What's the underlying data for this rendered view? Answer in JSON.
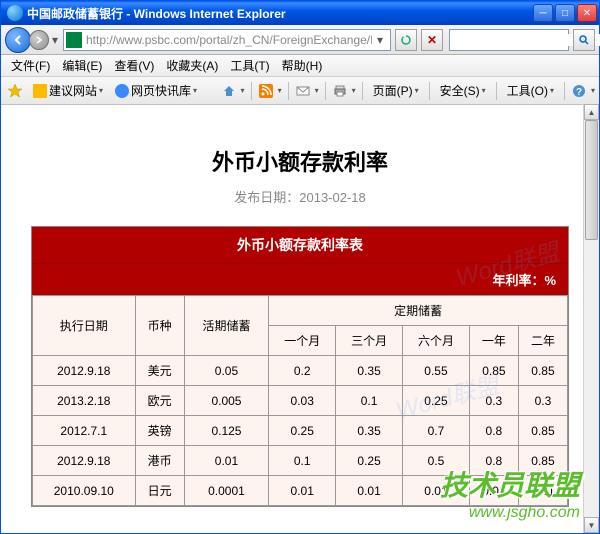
{
  "window": {
    "title": "中国邮政储蓄银行 - Windows Internet Explorer"
  },
  "address": {
    "url": "http://www.psbc.com/portal/zh_CN/ForeignExchange/Infomati"
  },
  "menus": {
    "file": "文件(F)",
    "edit": "编辑(E)",
    "view": "查看(V)",
    "favorites": "收藏夹(A)",
    "tools": "工具(T)",
    "help": "帮助(H)"
  },
  "toolbar": {
    "suggested": "建议网站",
    "quicknews": "网页快讯库",
    "page": "页面(P)",
    "safety": "安全(S)",
    "tools": "工具(O)"
  },
  "page": {
    "title": "外币小额存款利率",
    "date_label": "发布日期：",
    "date_value": "2013-02-18"
  },
  "table": {
    "caption": "外币小额存款利率表",
    "unit": "年利率：%",
    "headers": {
      "exec_date": "执行日期",
      "currency": "币种",
      "demand": "活期储蓄",
      "fixed": "定期储蓄",
      "m1": "一个月",
      "m3": "三个月",
      "m6": "六个月",
      "y1": "一年",
      "y2": "二年"
    },
    "rows": [
      {
        "date": "2012.9.18",
        "cur": "美元",
        "demand": "0.05",
        "m1": "0.2",
        "m3": "0.35",
        "m6": "0.55",
        "y1": "0.85",
        "y2": "0.85"
      },
      {
        "date": "2013.2.18",
        "cur": "欧元",
        "demand": "0.005",
        "m1": "0.03",
        "m3": "0.1",
        "m6": "0.25",
        "y1": "0.3",
        "y2": "0.3"
      },
      {
        "date": "2012.7.1",
        "cur": "英镑",
        "demand": "0.125",
        "m1": "0.25",
        "m3": "0.35",
        "m6": "0.7",
        "y1": "0.8",
        "y2": "0.85"
      },
      {
        "date": "2012.9.18",
        "cur": "港币",
        "demand": "0.01",
        "m1": "0.1",
        "m3": "0.25",
        "m6": "0.5",
        "y1": "0.8",
        "y2": "0.85"
      },
      {
        "date": "2010.09.10",
        "cur": "日元",
        "demand": "0.0001",
        "m1": "0.01",
        "m3": "0.01",
        "m6": "0.01",
        "y1": "0.01",
        "y2": "0.01"
      }
    ]
  },
  "watermark": "Word联盟",
  "footer": {
    "line1": "技术员联盟",
    "line2": "www.jsgho.com"
  }
}
